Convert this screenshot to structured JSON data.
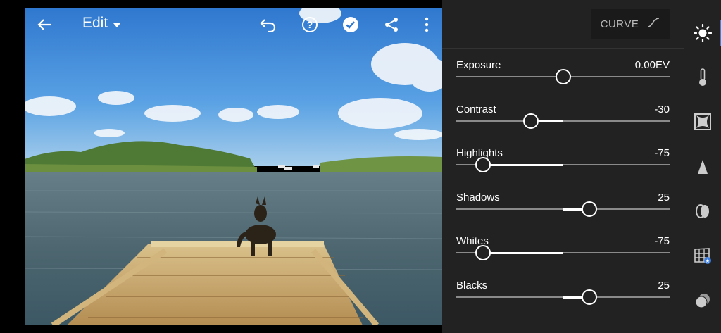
{
  "header": {
    "title": "Edit",
    "icons": [
      "back-arrow-icon",
      "chevron-down-icon",
      "undo-icon",
      "help-icon",
      "checkmark-icon",
      "share-icon",
      "more-vertical-icon"
    ]
  },
  "curve_button": {
    "label": "CURVE",
    "icon": "curve-icon"
  },
  "adjustments": [
    {
      "label": "Exposure",
      "value": "0.00EV",
      "position": 0.5
    },
    {
      "label": "Contrast",
      "value": "-30",
      "position": 0.35
    },
    {
      "label": "Highlights",
      "value": "-75",
      "position": 0.125
    },
    {
      "label": "Shadows",
      "value": "25",
      "position": 0.625
    },
    {
      "label": "Whites",
      "value": "-75",
      "position": 0.125
    },
    {
      "label": "Blacks",
      "value": "25",
      "position": 0.625
    }
  ],
  "rail": {
    "icons": [
      "light-icon",
      "color-thermometer-icon",
      "effects-vignette-icon",
      "detail-sharpen-icon",
      "optics-lens-icon",
      "geometry-grid-icon",
      "presets-icon"
    ],
    "active": "light-icon",
    "accent_color": "#3d7fe0"
  },
  "colors": {
    "panel": "#222222",
    "track": "#8a8a8a",
    "text": "#ffffff"
  }
}
